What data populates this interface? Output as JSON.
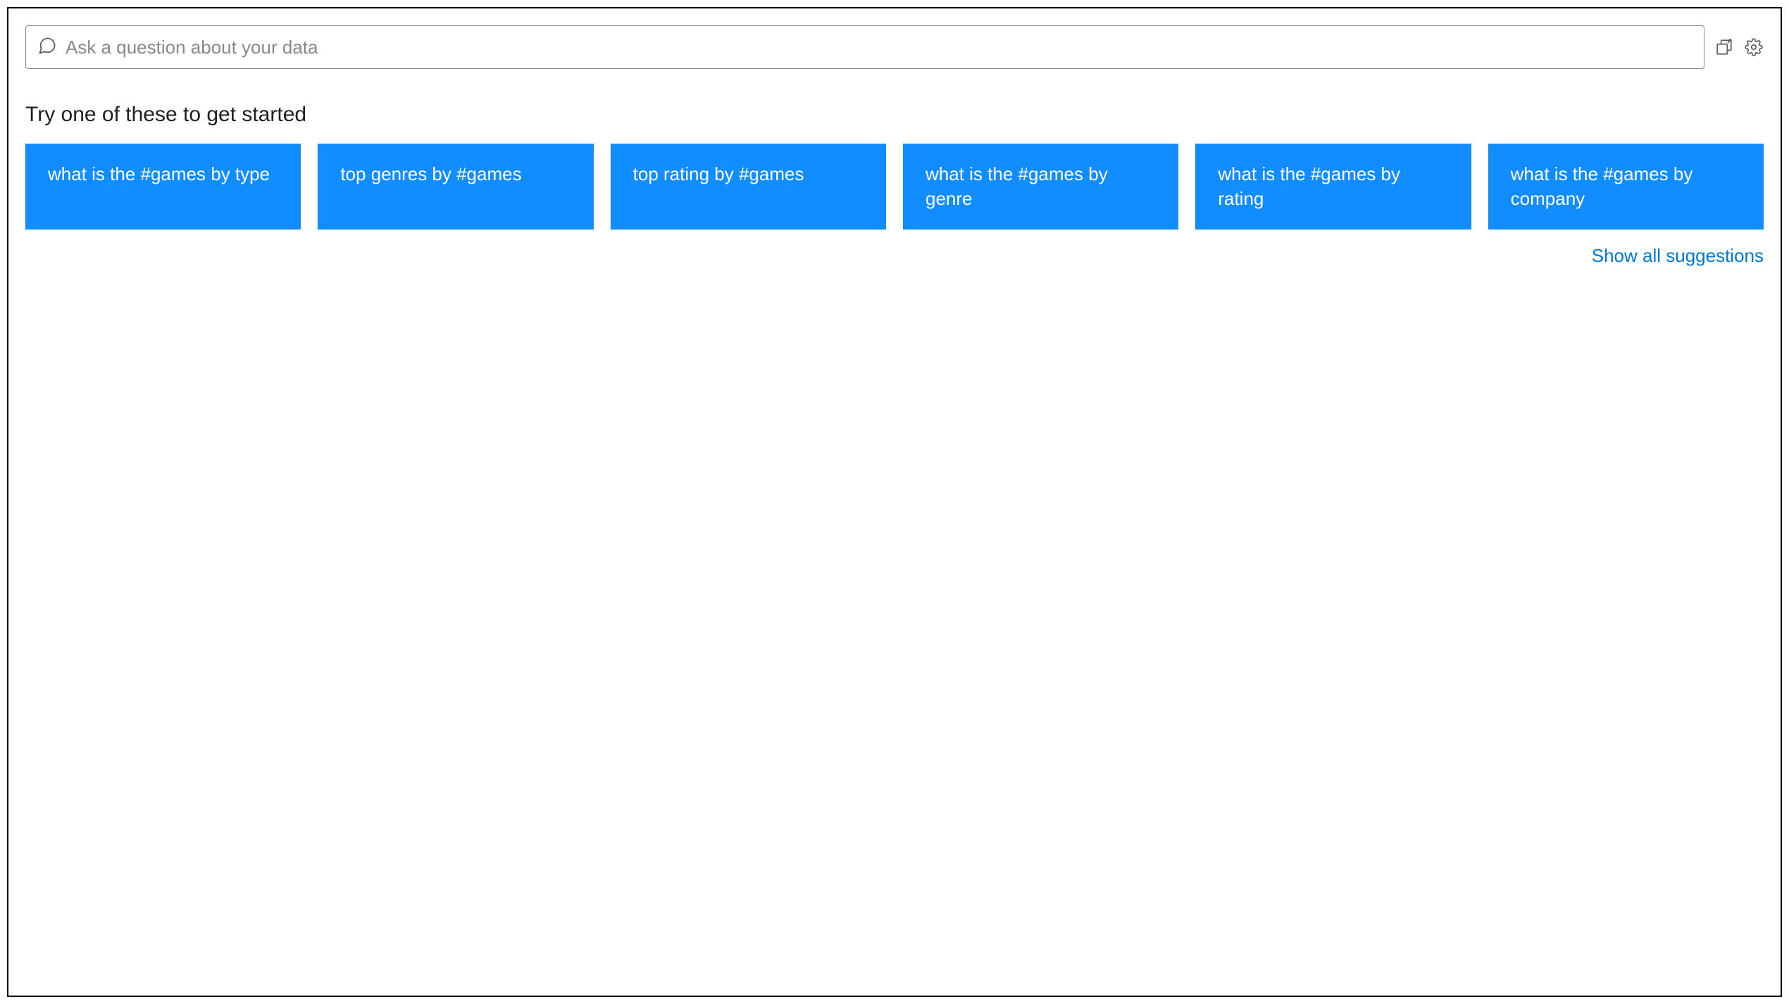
{
  "search": {
    "placeholder": "Ask a question about your data",
    "value": ""
  },
  "icons": {
    "chat": "chat-icon",
    "add_visual": "add-visual-icon",
    "settings": "gear-icon"
  },
  "heading": "Try one of these to get started",
  "suggestions": [
    {
      "label": "what is the #games by type"
    },
    {
      "label": "top genres by #games"
    },
    {
      "label": "top rating by #games"
    },
    {
      "label": "what is the #games by genre"
    },
    {
      "label": "what is the #games by rating"
    },
    {
      "label": "what is the #games by company"
    }
  ],
  "show_all_label": "Show all suggestions",
  "colors": {
    "card_bg": "#118dff",
    "link": "#0078d4"
  }
}
